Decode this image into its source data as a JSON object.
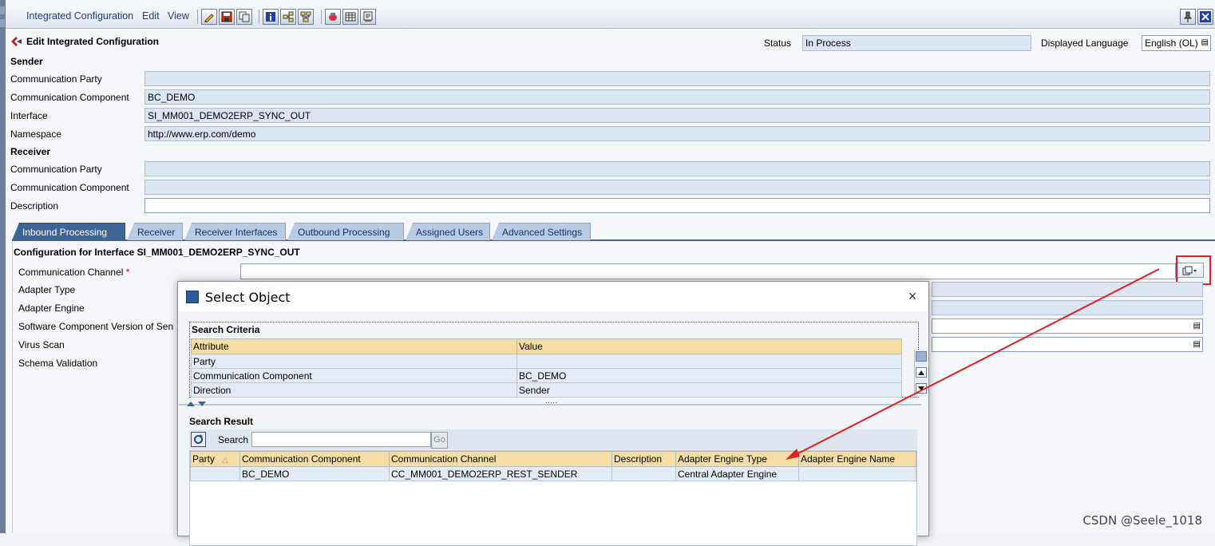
{
  "menu": {
    "items": [
      "Integrated Configuration",
      "Edit",
      "View"
    ]
  },
  "header": {
    "title": "Edit Integrated Configuration",
    "status_label": "Status",
    "status_value": "In Process",
    "language_label": "Displayed Language",
    "language_value": "English (OL)"
  },
  "sender": {
    "title": "Sender",
    "fields": [
      {
        "label": "Communication Party",
        "value": ""
      },
      {
        "label": "Communication Component",
        "value": "BC_DEMO"
      },
      {
        "label": "Interface",
        "value": "SI_MM001_DEMO2ERP_SYNC_OUT"
      },
      {
        "label": "Namespace",
        "value": "http://www.erp.com/demo"
      }
    ]
  },
  "receiver": {
    "title": "Receiver",
    "fields": [
      {
        "label": "Communication Party",
        "value": ""
      },
      {
        "label": "Communication Component",
        "value": ""
      },
      {
        "label": "Description",
        "value": ""
      }
    ]
  },
  "tabs": [
    "Inbound Processing",
    "Receiver",
    "Receiver Interfaces",
    "Outbound Processing",
    "Assigned Users",
    "Advanced Settings"
  ],
  "inbound": {
    "title": "Configuration for Interface SI_MM001_DEMO2ERP_SYNC_OUT",
    "labels": [
      "Communication Channel",
      "Adapter Type",
      "Adapter Engine",
      "Software Component Version of Sen",
      "Virus Scan",
      "Schema Validation"
    ],
    "required_mark": "*"
  },
  "dialog": {
    "title": "Select Object",
    "close": "×",
    "criteria_title": "Search Criteria",
    "criteria_headers": [
      "Attribute",
      "Value"
    ],
    "criteria_rows": [
      [
        "Party",
        ""
      ],
      [
        "Communication Component",
        "BC_DEMO"
      ],
      [
        "Direction",
        "Sender"
      ]
    ],
    "splitter_dots": ".....",
    "result_title": "Search Result",
    "search_label": "Search",
    "search_value": "",
    "go_label": "Go",
    "result_headers": [
      "Party",
      "Communication Component",
      "Communication Channel",
      "Description",
      "Adapter Engine Type",
      "Adapter Engine Name"
    ],
    "sort_glyph": "△",
    "result_rows": [
      [
        "",
        "BC_DEMO",
        "CC_MM001_DEMO2ERP_REST_SENDER",
        "",
        "Central Adapter Engine",
        ""
      ]
    ]
  },
  "watermark": "CSDN @Seele_1018",
  "colors": {
    "annotation": "#e02020",
    "tab_active": "#3e6593",
    "header_cell": "#f5dea6"
  }
}
